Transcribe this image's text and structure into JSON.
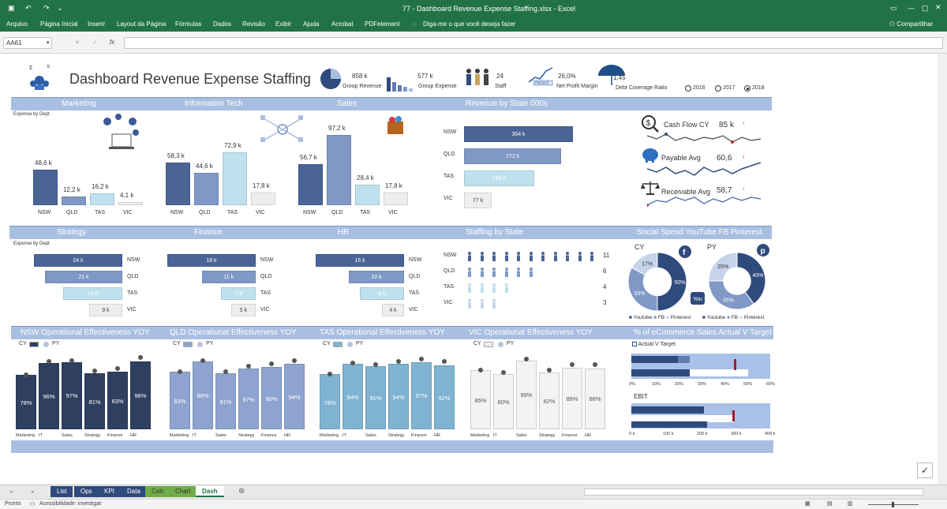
{
  "window": {
    "title": "77 - Dashboard Revenue Expense Staffing.xlsx  -  Excel",
    "share": "Compartilhar"
  },
  "menu": [
    "Arquivo",
    "Página Inicial",
    "Inserir",
    "Layout da Página",
    "Fórmulas",
    "Dados",
    "Revisão",
    "Exibir",
    "Ajuda",
    "Acrobat",
    "PDFelement",
    "Diga-me o que você deseja fazer"
  ],
  "formula": {
    "namebox": "AA61",
    "fx": "fx",
    "value": ""
  },
  "dashboard": {
    "title": "Dashboard Revenue Expense Staffing",
    "kpis": {
      "group_revenue_value": "858 k",
      "group_revenue_label": "Group Revenue",
      "group_expense_value": "577 k",
      "group_expense_label": "Group Expense",
      "staff_value": "24",
      "staff_label": "Staff",
      "npm_value": "26,0%",
      "npm_label": "Net Profit Margin",
      "npm_icon_text": "PROFIT",
      "dcr_value": "1,45",
      "dcr_label": "Debt Coverage Ratio"
    },
    "years": {
      "y2016": "2016",
      "y2017": "2017",
      "y2018": "2018",
      "selected": "2018"
    }
  },
  "sections": {
    "marketing": "Marketing",
    "it": "Information Tech",
    "sales": "Sales",
    "rev_state": "Revenue by State 000s",
    "strategy": "Strategy",
    "finance": "Finance",
    "hr": "HR",
    "staffing": "Staffing by State",
    "social": "Social Spend YouTube FB Pinterest",
    "nsw_op": "NSW Operational Effectiveness YOY",
    "qld_op": "QLD Operational Effectiveness YOY",
    "tas_op": "TAS Operational Effectiveness YOY",
    "vic_op": "VIC Operational Effectiveness YOY",
    "ecom": "% of eCommerce Sales Actual V Target"
  },
  "labels": {
    "expense_by_dept": "Expense by Dept",
    "expense_by_dept2": "Expense by Dept",
    "cy": "CY",
    "py": "PY",
    "actual_target": "Actual V Target",
    "ebit": "EBIT"
  },
  "dept_charts": [
    {
      "name": "Marketing",
      "values": [
        "48,6 k",
        "12,2 k",
        "16,2 k",
        "4,1 k"
      ],
      "nums": [
        48.6,
        12.2,
        16.2,
        4.1
      ]
    },
    {
      "name": "Information Tech",
      "values": [
        "58,3 k",
        "44,6 k",
        "72,9 k",
        "17,8 k"
      ],
      "nums": [
        58.3,
        44.6,
        72.9,
        17.8
      ]
    },
    {
      "name": "Sales",
      "values": [
        "56,7 k",
        "97,2 k",
        "28,4 k",
        "17,8 k"
      ],
      "nums": [
        56.7,
        97.2,
        28.4,
        17.8
      ]
    }
  ],
  "states": [
    "NSW",
    "QLD",
    "TAS",
    "VIC"
  ],
  "rev_state": {
    "values": [
      "304 k",
      "272 k",
      "195 k",
      "77 k"
    ],
    "nums": [
      304,
      272,
      195,
      77
    ]
  },
  "side_kpis": {
    "cash_label": "Cash Flow CY",
    "cash_value": "85 k",
    "payable_label": "Payable Avg",
    "payable_value": "60,6",
    "receivable_label": "Receivable Avg",
    "receivable_value": "58,7"
  },
  "hbar_charts": [
    {
      "name": "Strategy",
      "values": [
        "24 k",
        "21 k",
        "16 k",
        "9 k"
      ],
      "nums": [
        24,
        21,
        16,
        9
      ]
    },
    {
      "name": "Finance",
      "values": [
        "18 k",
        "11 k",
        "7 k",
        "5 k"
      ],
      "nums": [
        18,
        11,
        7,
        5
      ]
    },
    {
      "name": "HR",
      "values": [
        "16 k",
        "10 k",
        "8 k",
        "4 k"
      ],
      "nums": [
        16,
        10,
        8,
        4
      ]
    }
  ],
  "staffing": {
    "counts": [
      "11",
      "6",
      "4",
      "3"
    ],
    "nums": [
      11,
      6,
      4,
      3
    ]
  },
  "social": {
    "cy": {
      "youtube": "50%",
      "fb": "33%",
      "pinterest": "17%",
      "nums": [
        50,
        33,
        17
      ]
    },
    "py": {
      "youtube": "40%",
      "fb": "35%",
      "pinterest": "25%",
      "nums": [
        40,
        35,
        25
      ]
    },
    "legend": [
      "Youtube",
      "FB",
      "Pinterest"
    ]
  },
  "op_categories": [
    "Marketing",
    "IT",
    "Sales",
    "Strategy",
    "Finance",
    "HR"
  ],
  "op_charts": [
    {
      "name": "NSW",
      "values": [
        "78%",
        "96%",
        "97%",
        "81%",
        "83%",
        "98%"
      ],
      "nums": [
        78,
        96,
        97,
        81,
        83,
        98
      ],
      "color": "#2f3f5f"
    },
    {
      "name": "QLD",
      "values": [
        "83%",
        "98%",
        "81%",
        "87%",
        "90%",
        "94%"
      ],
      "nums": [
        83,
        98,
        81,
        87,
        90,
        94
      ],
      "color": "#8ea3cf"
    },
    {
      "name": "TAS",
      "values": [
        "79%",
        "94%",
        "91%",
        "94%",
        "97%",
        "92%"
      ],
      "nums": [
        79,
        94,
        91,
        94,
        97,
        92
      ],
      "color": "#7fb3d1"
    },
    {
      "name": "VIC",
      "values": [
        "85%",
        "80%",
        "99%",
        "82%",
        "89%",
        "88%"
      ],
      "nums": [
        85,
        80,
        99,
        82,
        89,
        88
      ],
      "color": "#f3f3f3"
    }
  ],
  "ecom_axis": [
    "0%",
    "10%",
    "20%",
    "30%",
    "40%",
    "50%",
    "60%"
  ],
  "ebit_axis": [
    "0 k",
    "100 k",
    "200 k",
    "300 k",
    "400 k"
  ],
  "sheet_tabs": [
    "List",
    "Ops",
    "KPI",
    "Data",
    "Calc",
    "Chart",
    "Dash"
  ],
  "status": {
    "ready": "Pronto",
    "accessibility": "Acessibilidade: investigar"
  },
  "colors": {
    "excel_green": "#217346",
    "section_blue": "#a9bfe2",
    "dark_navy": "#2f3f5f",
    "mid_blue": "#5f7bb0"
  }
}
